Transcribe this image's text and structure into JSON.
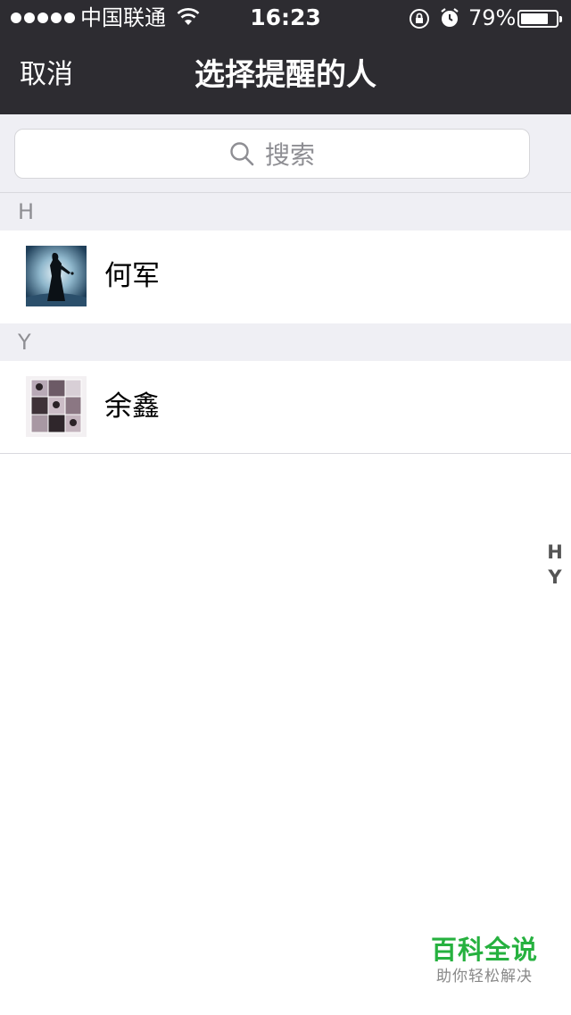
{
  "status_bar": {
    "carrier": "中国联通",
    "time": "16:23",
    "battery_percent": "79%",
    "battery_level": 0.79,
    "icons": [
      "signal-dots-icon",
      "wifi-icon",
      "rotation-lock-icon",
      "alarm-icon",
      "battery-icon"
    ]
  },
  "nav": {
    "cancel_label": "取消",
    "title": "选择提醒的人"
  },
  "search": {
    "placeholder": "搜索",
    "icon": "search-icon"
  },
  "sections": [
    {
      "letter": "H",
      "contacts": [
        {
          "name": "何军",
          "avatar": "avatar-silhouette-icon"
        }
      ]
    },
    {
      "letter": "Y",
      "contacts": [
        {
          "name": "余鑫",
          "avatar": "avatar-photo-collage-icon"
        }
      ]
    }
  ],
  "index_bar": [
    "H",
    "Y"
  ],
  "watermark": {
    "title": "百科全说",
    "subtitle": "助你轻松解决"
  },
  "colors": {
    "nav_background": "#2d2c31",
    "section_background": "#efeff4",
    "watermark_green": "#26b13f"
  }
}
